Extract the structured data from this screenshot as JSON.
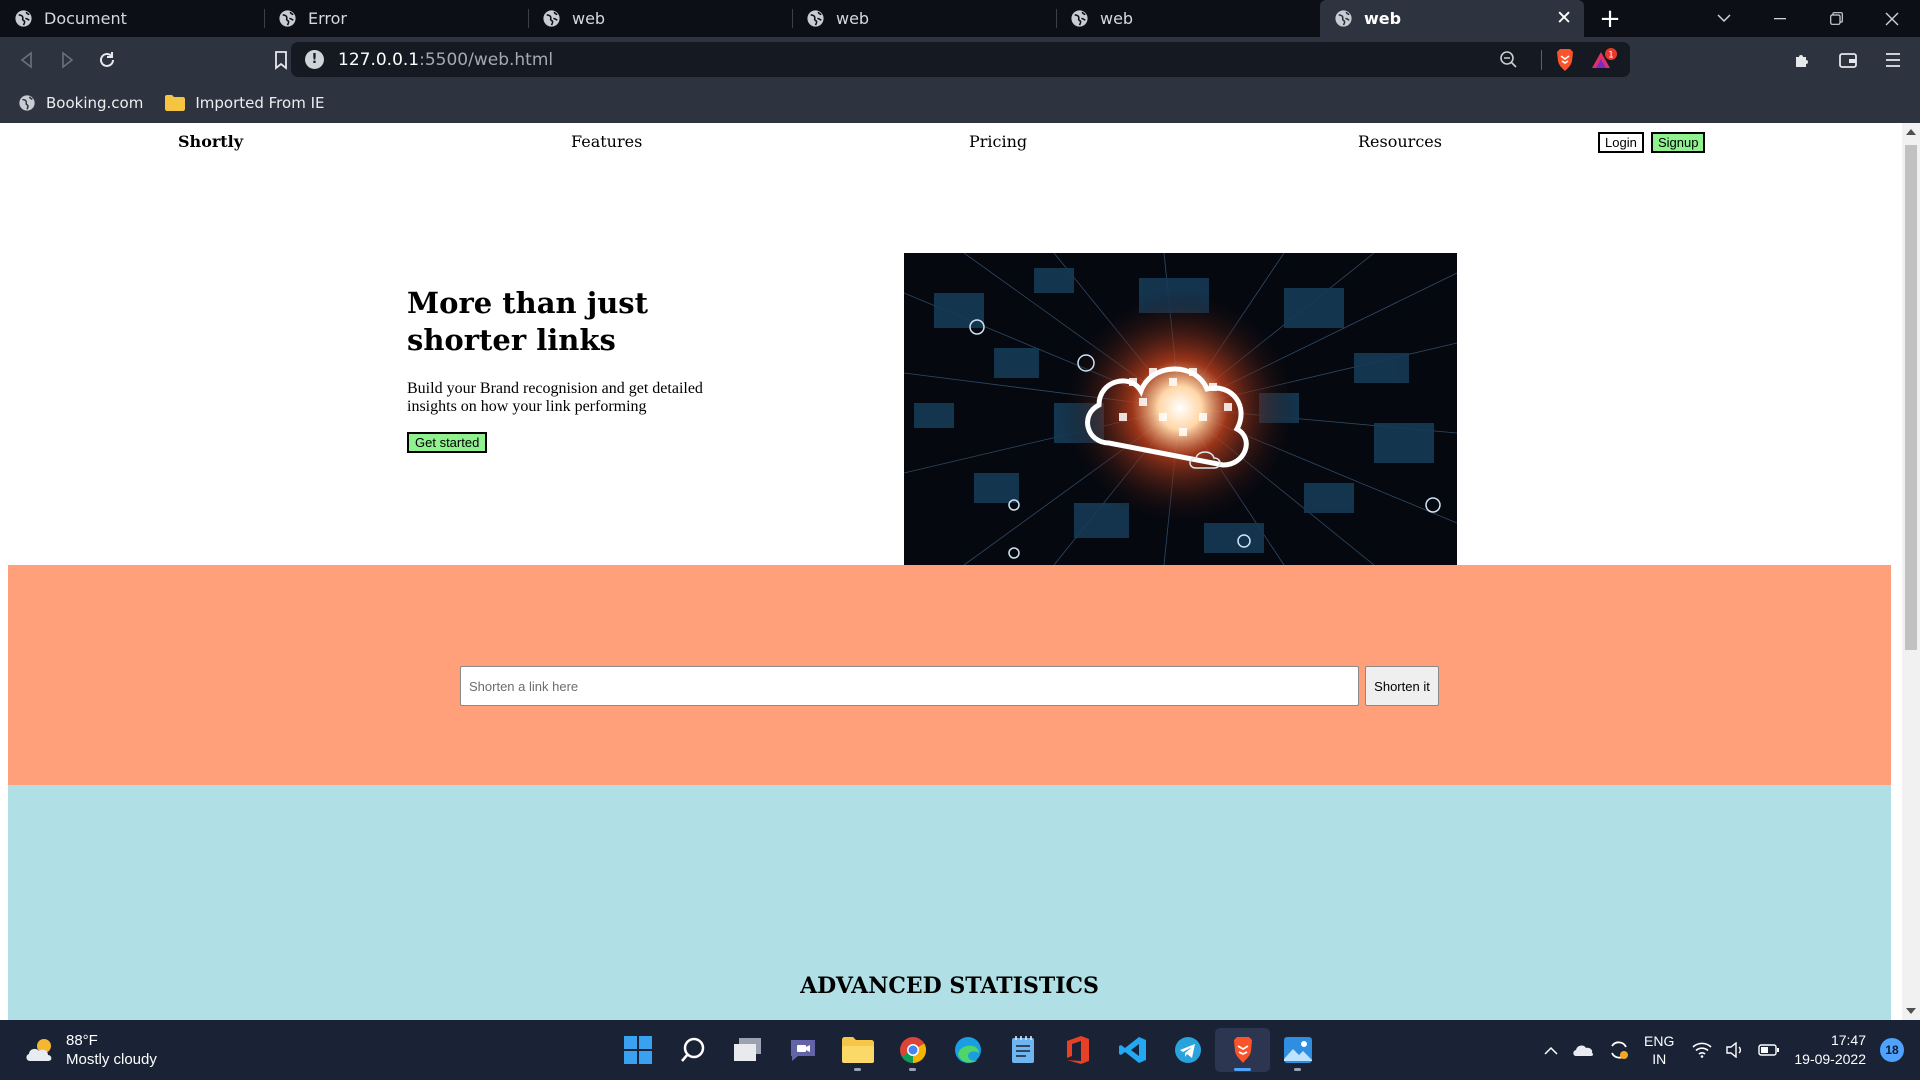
{
  "browser": {
    "tabs": [
      {
        "title": "Document",
        "active": false
      },
      {
        "title": "Error",
        "active": false
      },
      {
        "title": "web",
        "active": false
      },
      {
        "title": "web",
        "active": false
      },
      {
        "title": "web",
        "active": false
      },
      {
        "title": "web",
        "active": true
      }
    ],
    "close_glyph": "✕",
    "new_tab_glyph": "+",
    "url_host": "127.0.0.1",
    "url_path": ":5500/web.html",
    "info_glyph": "!",
    "rewards_badge": "1",
    "bookmarks": [
      {
        "label": "Booking.com",
        "icon": "globe-icon"
      },
      {
        "label": "Imported From IE",
        "icon": "folder-icon"
      }
    ],
    "accent": "#2d333f"
  },
  "site": {
    "nav": {
      "brand": "Shortly",
      "links": [
        "Features",
        "Pricing",
        "Resources"
      ],
      "login_label": "Login",
      "signup_label": "Signup"
    },
    "hero": {
      "title": "More than just shorter links",
      "subtitle": "Build your Brand recognision and get detailed insights on how your link performing",
      "cta_label": "Get started",
      "image_icon": "cloud-network-illustration"
    },
    "shorten": {
      "placeholder": "Shorten a link here",
      "button_label": "Shorten it",
      "band_color": "#ffa07a"
    },
    "stats": {
      "title": "ADVANCED STATISTICS",
      "band_color": "#b0dfe5"
    },
    "button_green": "#8ff28f"
  },
  "taskbar": {
    "weather_temp": "88°F",
    "weather_desc": "Mostly cloudy",
    "lang_line1": "ENG",
    "lang_line2": "IN",
    "time": "17:47",
    "date": "19-09-2022",
    "notifications": "18",
    "apps": [
      "start-icon",
      "search-icon",
      "task-view-icon",
      "teams-chat-icon",
      "file-explorer-icon",
      "chrome-icon",
      "edge-icon",
      "notepad-icon",
      "office-icon",
      "vscode-icon",
      "telegram-icon",
      "brave-icon",
      "photos-icon"
    ]
  }
}
